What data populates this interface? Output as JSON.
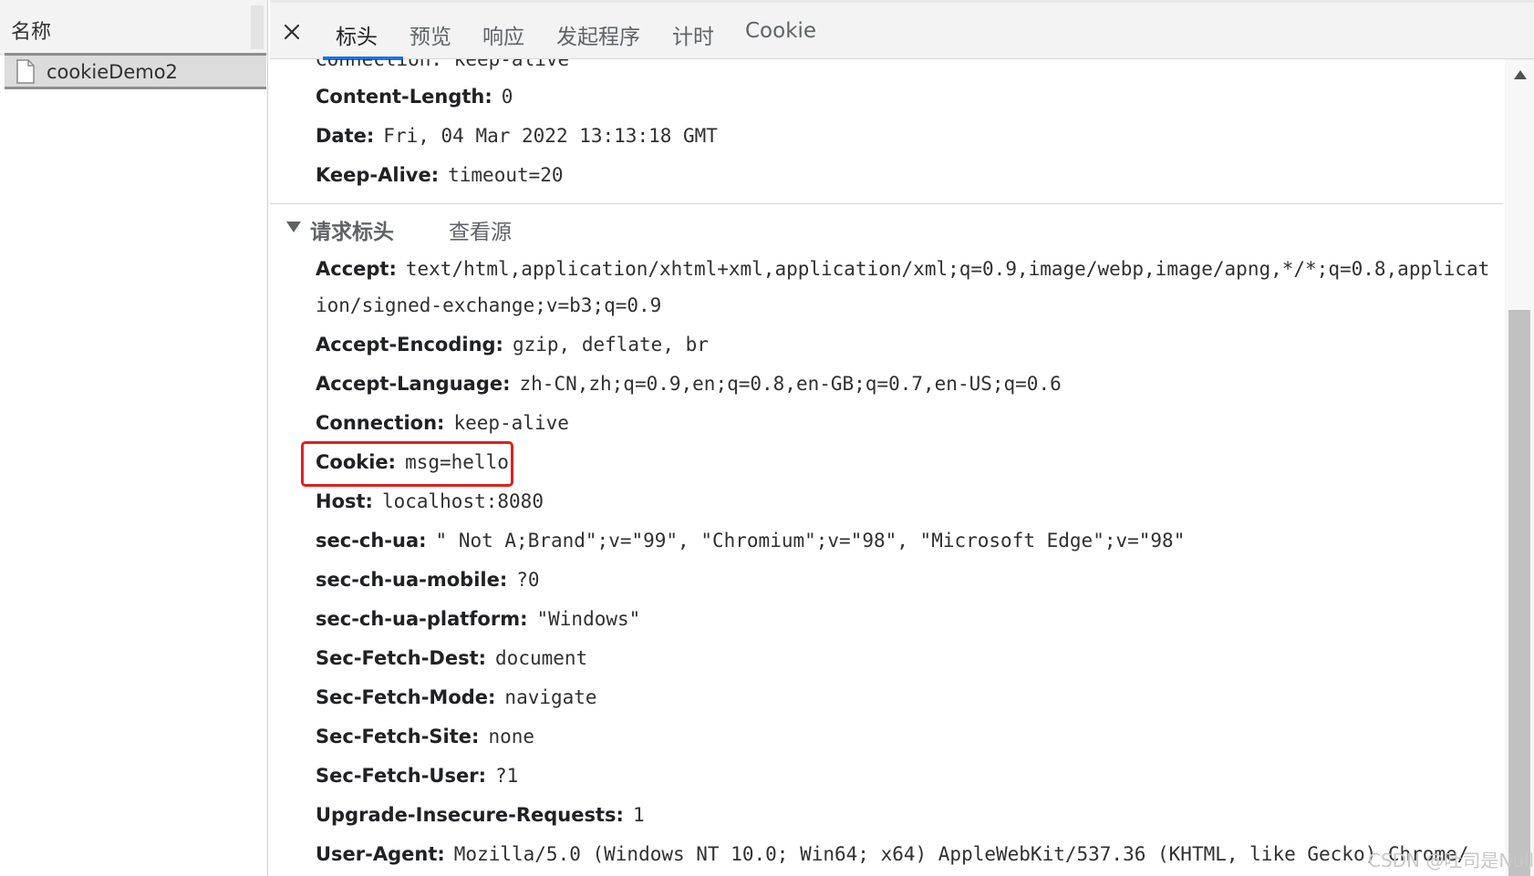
{
  "sidebar": {
    "header_label": "名称",
    "request_name": "cookieDemo2"
  },
  "tabs": [
    {
      "label": "标头",
      "active": true
    },
    {
      "label": "预览",
      "active": false
    },
    {
      "label": "响应",
      "active": false
    },
    {
      "label": "发起程序",
      "active": false
    },
    {
      "label": "计时",
      "active": false
    },
    {
      "label": "Cookie",
      "active": false
    }
  ],
  "response_headers": {
    "clipped_line": "Connection: keep-alive",
    "rows": [
      {
        "key": "Content-Length:",
        "value": "0"
      },
      {
        "key": "Date:",
        "value": "Fri, 04 Mar 2022 13:13:18 GMT"
      },
      {
        "key": "Keep-Alive:",
        "value": "timeout=20"
      }
    ]
  },
  "request_section": {
    "title": "请求标头",
    "view_source": "查看源"
  },
  "request_headers": {
    "accept_key": "Accept:",
    "accept_value": "text/html,application/xhtml+xml,application/xml;q=0.9,image/webp,image/apng,*/*;q=0.8,applicat",
    "accept_continuation": "ion/signed-exchange;v=b3;q=0.9",
    "rows": [
      {
        "key": "Accept-Encoding:",
        "value": "gzip, deflate, br"
      },
      {
        "key": "Accept-Language:",
        "value": "zh-CN,zh;q=0.9,en;q=0.8,en-GB;q=0.7,en-US;q=0.6"
      },
      {
        "key": "Connection:",
        "value": "keep-alive"
      },
      {
        "key": "Cookie:",
        "value": "msg=hello",
        "highlighted": true
      },
      {
        "key": "Host:",
        "value": "localhost:8080"
      },
      {
        "key": "sec-ch-ua:",
        "value": "\" Not A;Brand\";v=\"99\", \"Chromium\";v=\"98\", \"Microsoft Edge\";v=\"98\""
      },
      {
        "key": "sec-ch-ua-mobile:",
        "value": "?0"
      },
      {
        "key": "sec-ch-ua-platform:",
        "value": "\"Windows\""
      },
      {
        "key": "Sec-Fetch-Dest:",
        "value": "document"
      },
      {
        "key": "Sec-Fetch-Mode:",
        "value": "navigate"
      },
      {
        "key": "Sec-Fetch-Site:",
        "value": "none"
      },
      {
        "key": "Sec-Fetch-User:",
        "value": "?1"
      },
      {
        "key": "Upgrade-Insecure-Requests:",
        "value": "1"
      },
      {
        "key": "User-Agent:",
        "value": "Mozilla/5.0 (Windows NT 10.0; Win64; x64) AppleWebKit/537.36 (KHTML, like Gecko) Chrome/"
      }
    ]
  },
  "watermark": "CSDN @吐司是Null",
  "colors": {
    "accent": "#1a73e8",
    "highlight_border": "#e0201b"
  }
}
